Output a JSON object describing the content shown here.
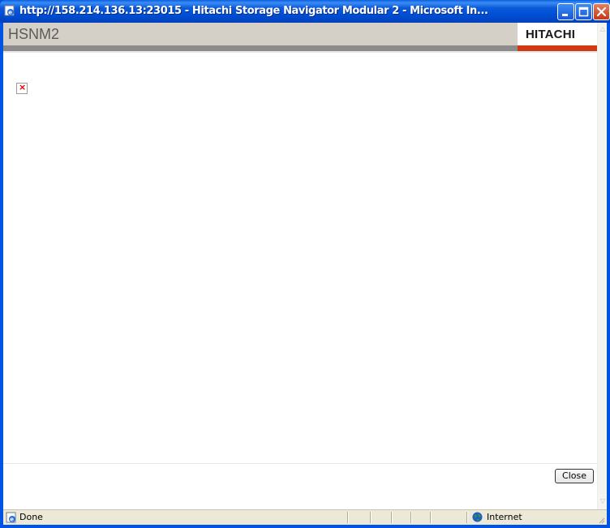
{
  "window": {
    "title": "http://158.214.136.13:23015 - Hitachi Storage Navigator Modular 2 - Microsoft In...",
    "icon": "ie-page-icon",
    "controls": [
      "minimize-icon",
      "maximize-icon",
      "close-icon"
    ]
  },
  "header": {
    "title": "HSNM2",
    "logo": "HITACHI",
    "accent_color": "#d03a12"
  },
  "content": {
    "broken_image_icon": "broken-image-icon"
  },
  "footer": {
    "close_label": "Close"
  },
  "statusbar": {
    "status_text": "Done",
    "zone_text": "Internet"
  }
}
